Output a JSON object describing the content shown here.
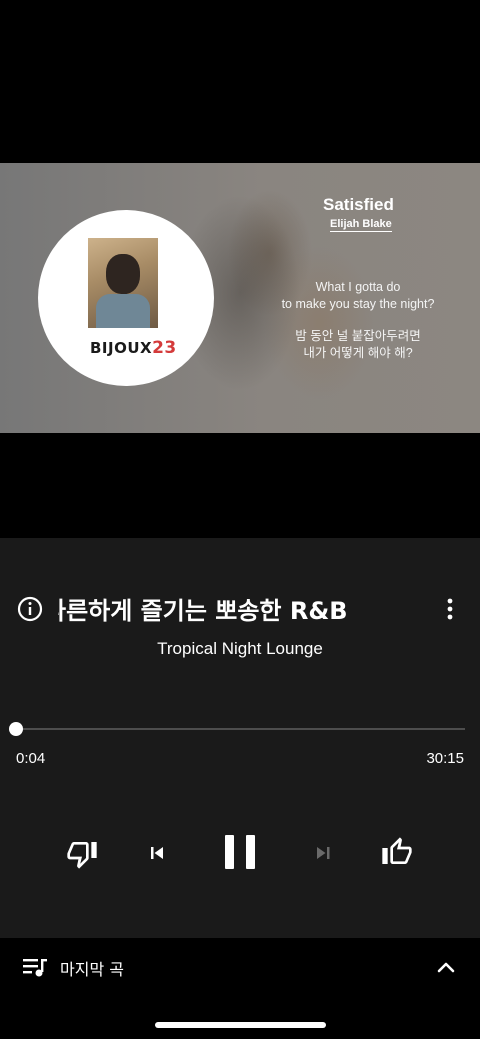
{
  "video": {
    "song_title": "Satisfied",
    "artist": "Elijah Blake",
    "album_cover_text": "BIJOUX",
    "album_cover_number": "23",
    "lyrics_en_1": "What I gotta do",
    "lyrics_en_2": "to make you stay the night?",
    "lyrics_ko_1": "밤 동안 널 붙잡아두려면",
    "lyrics_ko_2": "내가 어떻게 해야 해?"
  },
  "player": {
    "title": "나른하게 즐기는 뽀송한 R&B",
    "subtitle": "Tropical Night Lounge",
    "progress_fraction": 0.002,
    "time_elapsed": "0:04",
    "time_total": "30:15",
    "info_icon": "info-icon",
    "more_icon": "more-vert-icon"
  },
  "controls": {
    "dislike_icon": "thumb-down-icon",
    "previous_icon": "skip-previous-icon",
    "playpause_icon": "pause-icon",
    "next_icon": "skip-next-icon",
    "like_icon": "thumb-up-icon"
  },
  "queue": {
    "label": "마지막 곡",
    "icon": "queue-music-icon",
    "expand_icon": "chevron-up-icon"
  },
  "colors": {
    "panel_bg": "#1a1a1a",
    "track": "#4d4d4d",
    "text": "#ffffff"
  }
}
